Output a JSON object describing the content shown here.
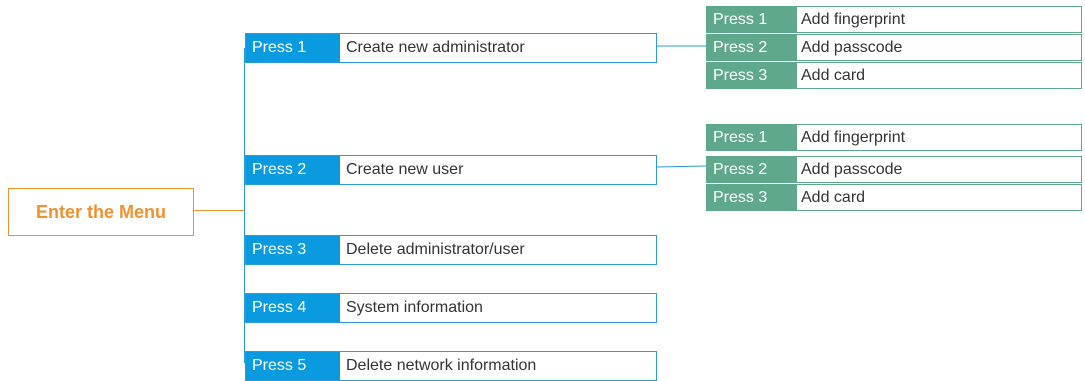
{
  "root": {
    "label": "Enter the Menu"
  },
  "menu": [
    {
      "key": "Press 1",
      "label": "Create new administrator"
    },
    {
      "key": "Press 2",
      "label": "Create new user"
    },
    {
      "key": "Press 3",
      "label": "Delete administrator/user"
    },
    {
      "key": "Press 4",
      "label": "System information"
    },
    {
      "key": "Press 5",
      "label": "Delete network information"
    }
  ],
  "submenu_admin": [
    {
      "key": "Press 1",
      "label": "Add fingerprint"
    },
    {
      "key": "Press 2",
      "label": "Add passcode"
    },
    {
      "key": "Press 3",
      "label": "Add card"
    }
  ],
  "submenu_user": [
    {
      "key": "Press 1",
      "label": "Add fingerprint"
    },
    {
      "key": "Press 2",
      "label": "Add passcode"
    },
    {
      "key": "Press 3",
      "label": "Add card"
    }
  ],
  "colors": {
    "root": "#f0912e",
    "menu_key": "#0a9ae0",
    "menu_border": "#2b9bd9",
    "submenu_key": "#5fa88b"
  }
}
